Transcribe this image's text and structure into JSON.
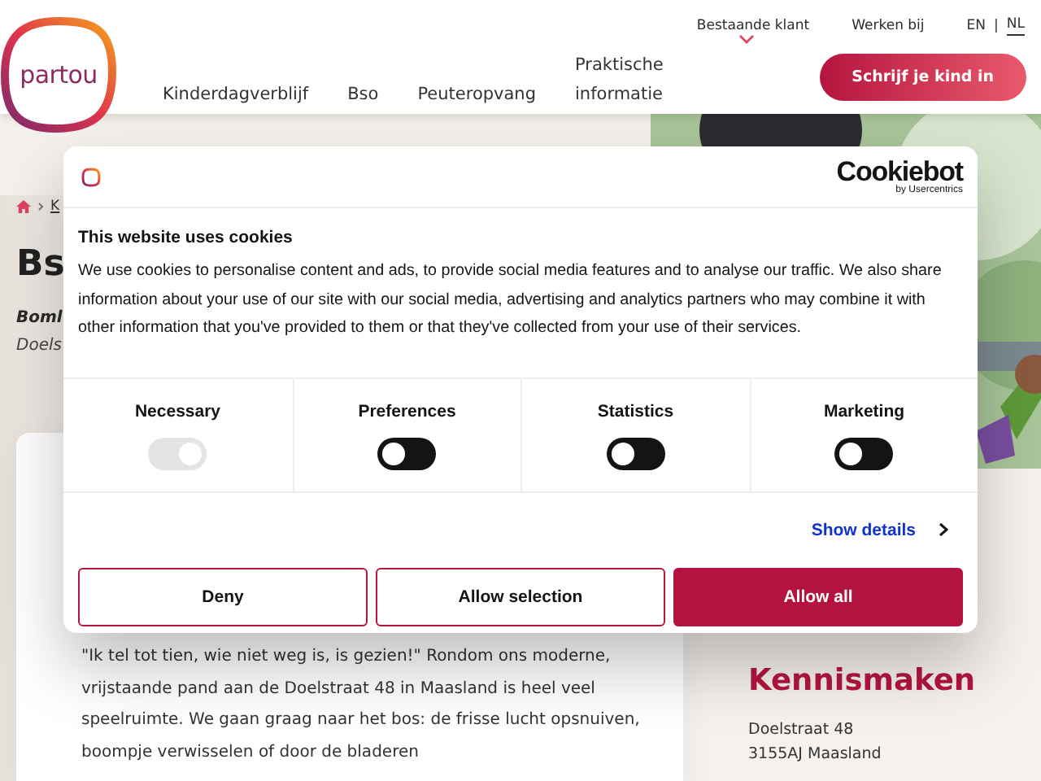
{
  "header": {
    "logo": "partou",
    "top_links": [
      {
        "label": "Bestaande klant"
      },
      {
        "label": "Werken bij"
      }
    ],
    "languages": [
      {
        "label": "EN",
        "selected": false
      },
      {
        "label": "NL",
        "selected": true
      }
    ],
    "language_separator": "|",
    "nav": [
      {
        "label": "Kinderdagverblijf"
      },
      {
        "label": "Bso"
      },
      {
        "label": "Peuteropvang"
      },
      {
        "label": "Praktische informatie"
      }
    ],
    "cta": "Schrijf je kind in"
  },
  "page": {
    "breadcrumb": [
      "K"
    ],
    "title": "Bs",
    "subtitle": "Boml",
    "address": "Doels",
    "intro": "\"Ik tel tot tien, wie niet weg is, is gezien!\" Rondom ons moderne, vrijstaande pand aan de Doelstraat 48 in Maasland is heel veel speelruimte. We gaan graag naar het bos: de frisse lucht opsnuiven, boompje verwisselen of door de bladeren",
    "contact": {
      "heading": "Kennismaken",
      "lines": [
        "Doelstraat 48",
        "3155AJ Maasland"
      ]
    }
  },
  "cookie_dialog": {
    "brand": "Cookiebot",
    "brand_sub": "by Usercentrics",
    "title": "This website uses cookies",
    "text": "We use cookies to personalise content and ads, to provide social media features and to analyse our traffic. We also share information about your use of our site with our social media, advertising and analytics partners who may combine it with other information that you've provided to them or that they've collected from your use of their services.",
    "categories": [
      {
        "label": "Necessary",
        "checked": true,
        "disabled": true
      },
      {
        "label": "Preferences",
        "checked": false,
        "disabled": false
      },
      {
        "label": "Statistics",
        "checked": false,
        "disabled": false
      },
      {
        "label": "Marketing",
        "checked": false,
        "disabled": false
      }
    ],
    "show_details": "Show details",
    "buttons": [
      {
        "label": "Deny",
        "kind": "outline"
      },
      {
        "label": "Allow selection",
        "kind": "outline"
      },
      {
        "label": "Allow all",
        "kind": "filled"
      }
    ]
  }
}
